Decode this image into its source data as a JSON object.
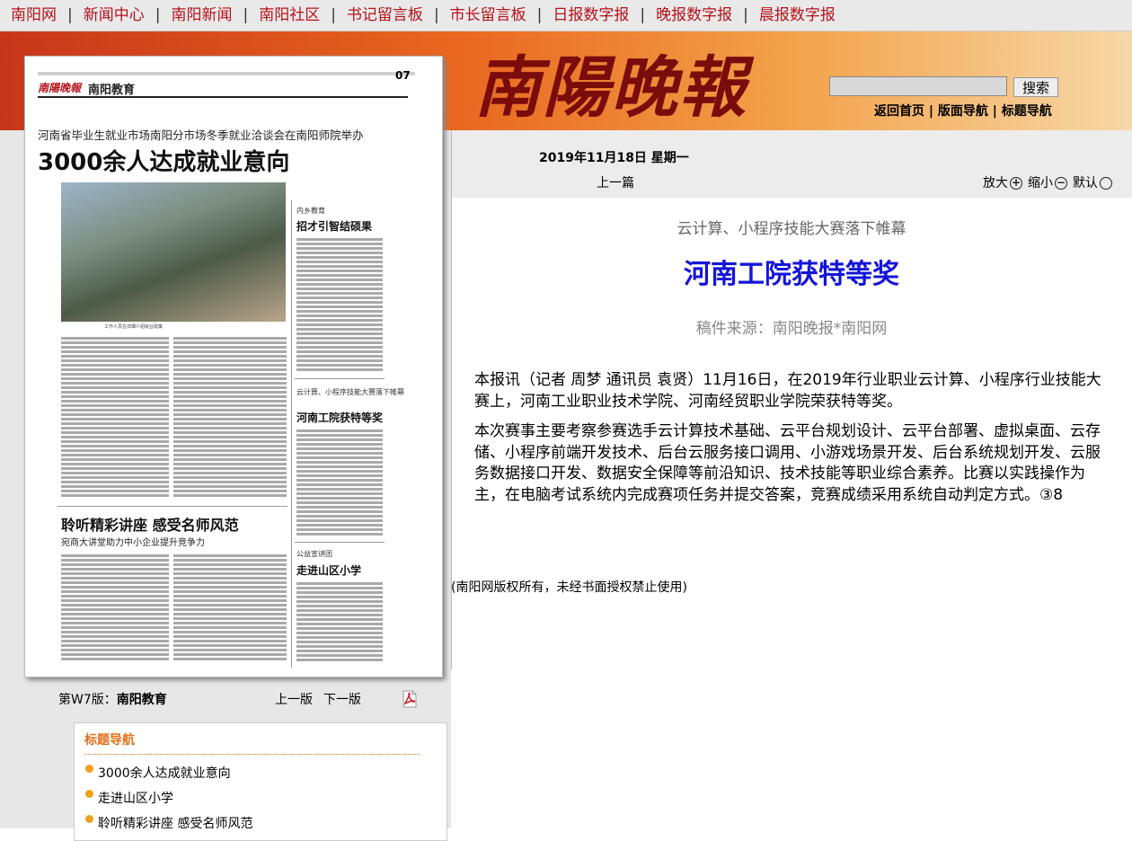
{
  "topnav": {
    "items": [
      "南阳网",
      "新闻中心",
      "南阳新闻",
      "南阳社区",
      "书记留言板",
      "市长留言板",
      "日报数字报",
      "晚报数字报",
      "晨报数字报"
    ]
  },
  "header": {
    "logo": "南陽晚報",
    "search_button": "搜索",
    "nav": [
      "返回首页",
      "版面导航",
      "标题导航"
    ]
  },
  "newspaper": {
    "page_number": "07",
    "masthead_logo": "南陽晚報",
    "section": "南阳教育",
    "lead_subhead": "河南省毕业生就业市场南阳分市场冬季就业洽谈会在南阳师院举办",
    "lead_headline": "3000余人达成就业意向",
    "photo_caption": "工作人员在详细介绍就业政策",
    "side1_kicker": "内乡教育",
    "side1_head": "招才引智结硕果",
    "side2_kicker": "云计算、小程序技能大赛落下帷幕",
    "side2_head": "河南工院获特等奖",
    "lecture_head": "聆听精彩讲座  感受名师风范",
    "lecture_sub": "宛商大讲堂助力中小企业提升竞争力",
    "side3_kicker": "公益宣讲团",
    "side3_head": "走进山区小学"
  },
  "pagebar": {
    "edition_prefix": "第W7版：",
    "edition_name": "南阳教育",
    "prev_page": "上一版",
    "next_page": "下一版"
  },
  "titlenav": {
    "heading": "标题导航",
    "items": [
      "3000余人达成就业意向",
      "走进山区小学",
      "聆听精彩讲座 感受名师风范"
    ]
  },
  "article": {
    "date": "2019年11月18日 星期一",
    "prev_article": "上一篇",
    "zoom_in": "放大",
    "zoom_out": "缩小",
    "zoom_default": "默认",
    "kicker": "云计算、小程序技能大赛落下帷幕",
    "headline": "河南工院获特等奖",
    "source": "稿件来源：南阳晚报*南阳网",
    "paragraphs": [
      "本报讯（记者 周梦 通讯员 袁贤）11月16日，在2019年行业职业云计算、小程序行业技能大赛上，河南工业职业技术学院、河南经贸职业学院荣获特等奖。",
      "本次赛事主要考察参赛选手云计算技术基础、云平台规划设计、云平台部署、虚拟桌面、云存储、小程序前端开发技术、后台云服务接口调用、小游戏场景开发、后台系统规划开发、云服务数据接口开发、数据安全保障等前沿知识、技术技能等职业综合素养。比赛以实践操作为主，在电脑考试系统内完成赛项任务并提交答案，竞赛成绩采用系统自动判定方式。③8"
    ],
    "copyright": "(南阳网版权所有，未经书面授权禁止使用)"
  },
  "colors": {
    "nav_red": "#b5121b",
    "headline_blue": "#1515d8",
    "banner_orange": "#e9661f",
    "titlenav_orange": "#e0701a"
  }
}
